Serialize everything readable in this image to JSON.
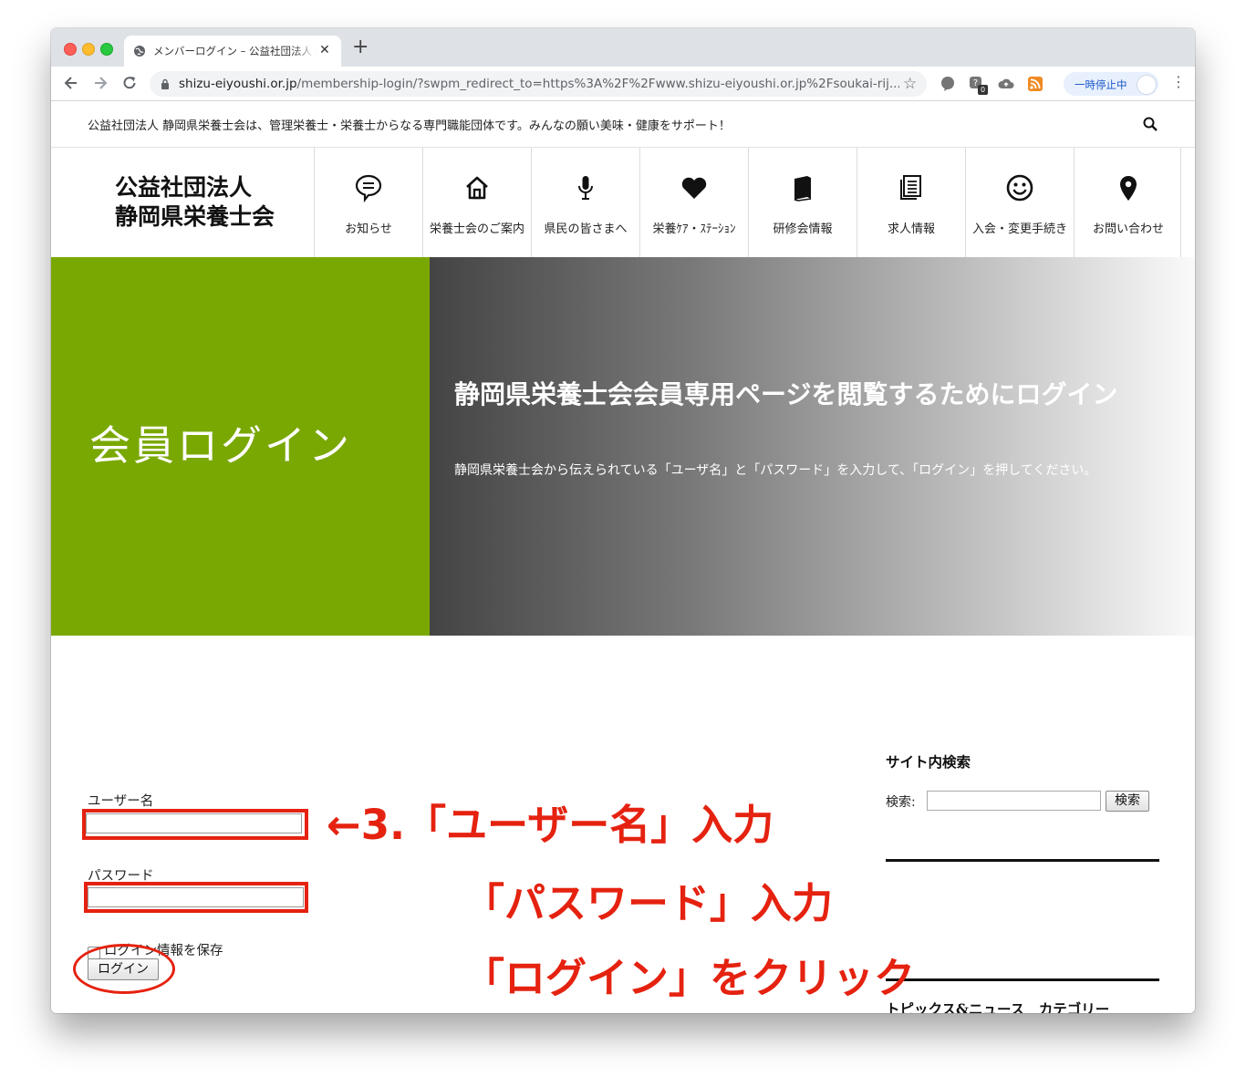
{
  "browser": {
    "tab_title": "メンバーログイン – 公益社団法人 静岡県栄養士会",
    "url_host": "shizu-eiyoushi.or.jp",
    "url_rest": "/membership-login/?swpm_redirect_to=https%3A%2F%2Fwww.shizu-eiyoushi.or.jp%2Fsoukai-rij...",
    "tab_close": "✕",
    "new_tab": "+",
    "star": "☆",
    "profile_status": "一時停止中",
    "menu": "⋮",
    "ext_badge": "0"
  },
  "site": {
    "tagline": "公益社団法人 静岡県栄養士会は、管理栄養士・栄養士からなる専門職能団体です。みんなの願い美味・健康をサポート！",
    "logo_line1": "公益社団法人",
    "logo_line2": "静岡県栄養士会",
    "nav": [
      {
        "label": "お知らせ",
        "icon": "speech-bubble-icon"
      },
      {
        "label": "栄養士会のご案内",
        "icon": "home-icon"
      },
      {
        "label": "県民の皆さまへ",
        "icon": "microphone-icon"
      },
      {
        "label": "栄養ｹｱ・ｽﾃｰｼｮﾝ",
        "icon": "heart-icon"
      },
      {
        "label": "研修会情報",
        "icon": "book-icon"
      },
      {
        "label": "求人情報",
        "icon": "document-icon"
      },
      {
        "label": "入会・変更手続き",
        "icon": "smiley-icon"
      },
      {
        "label": "お問い合わせ",
        "icon": "map-pin-icon"
      }
    ]
  },
  "hero": {
    "title": "会員ログイン",
    "heading": "静岡県栄養士会会員専用ページを閲覧するためにログイン",
    "description": "静岡県栄養士会から伝えられている「ユーザ名」と「パスワード」を入力して、「ログイン」を押してください。"
  },
  "login": {
    "username_label": "ユーザー名",
    "password_label": "パスワード",
    "remember_label": "ログイン情報を保存",
    "submit_label": "ログイン",
    "username_value": "",
    "password_value": ""
  },
  "sidebar": {
    "search_title": "サイト内検索",
    "search_label": "検索:",
    "search_button": "検索",
    "next_title": "トピックス&ニュース　カテゴリー"
  },
  "annotation": {
    "line1": "←3.「ユーザー名」入力",
    "line2": "「パスワード」入力",
    "line3": "「ログイン」をクリック"
  },
  "colors": {
    "hero_green": "#7aa803",
    "annotation_red": "#e52210"
  }
}
